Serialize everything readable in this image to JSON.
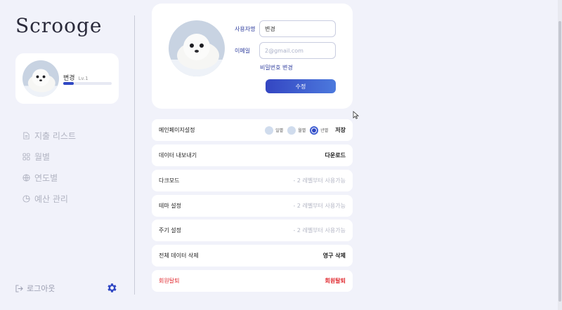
{
  "app": {
    "logo": "Scrooge"
  },
  "profile": {
    "name": "변경",
    "level": "Lv.1",
    "progress": 0.22
  },
  "nav": {
    "items": [
      {
        "label": "지출 리스트",
        "icon": "document-icon"
      },
      {
        "label": "월별",
        "icon": "grid-icon"
      },
      {
        "label": "연도별",
        "icon": "globe-icon"
      },
      {
        "label": "예산 관리",
        "icon": "pie-chart-icon"
      }
    ]
  },
  "footer": {
    "logout_label": "로그아웃",
    "settings_icon": "gear-icon"
  },
  "user_form": {
    "username_label": "사용자명",
    "username_value": "변경",
    "email_label": "이메일",
    "email_placeholder": "2@gmail.com",
    "password_link": "비밀번호 변경",
    "submit_label": "수정"
  },
  "settings": {
    "main_page": {
      "label": "메인페이지설정",
      "options": [
        "일별",
        "월별",
        "년별"
      ],
      "selected": "년별",
      "save_label": "저장"
    },
    "export": {
      "label": "데이터 내보내기",
      "action": "다운로드"
    },
    "dark_mode": {
      "label": "다크모드",
      "hint": "- 2 레벨부터 사용가능"
    },
    "theme": {
      "label": "테마 설정",
      "hint": "- 2 레벨부터 사용가능"
    },
    "cycle": {
      "label": "주기 설정",
      "hint": "- 2 레벨부터 사용가능"
    },
    "delete_all": {
      "label": "전체 데이터 삭제",
      "action": "영구 삭제"
    },
    "withdraw": {
      "label": "회원탈퇴",
      "action": "회원탈퇴"
    }
  },
  "colors": {
    "accent": "#3148c4",
    "danger": "#e0292f",
    "background": "#f1f2fa"
  }
}
